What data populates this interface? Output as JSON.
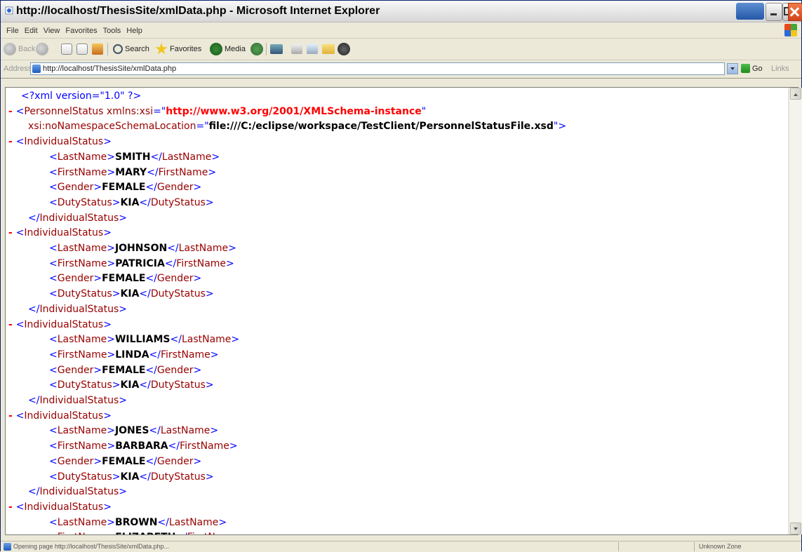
{
  "window": {
    "title": "http://localhost/ThesisSite/xmlData.php - Microsoft Internet Explorer"
  },
  "menu": [
    "File",
    "Edit",
    "View",
    "Favorites",
    "Tools",
    "Help"
  ],
  "toolbar": {
    "back": "Back",
    "search": "Search",
    "favorites": "Favorites",
    "media": "Media"
  },
  "address": {
    "label": "Address",
    "url": "http://localhost/ThesisSite/xmlData.php",
    "go": "Go",
    "links": "Links"
  },
  "xml": {
    "declaration": "<?xml version=\"1.0\" ?>",
    "root_tag": "PersonnelStatus",
    "xmlns_attr": "xmlns:xsi",
    "xmlns_value": "http://www.w3.org/2001/XMLSchema-instance",
    "schema_attr": "xsi:noNamespaceSchemaLocation",
    "schema_value": "file:///C:/eclipse/workspace/TestClient/PersonnelStatusFile.xsd",
    "record_tag": "IndividualStatus",
    "fields": [
      "LastName",
      "FirstName",
      "Gender",
      "DutyStatus"
    ],
    "records": [
      {
        "LastName": "SMITH",
        "FirstName": "MARY",
        "Gender": "FEMALE",
        "DutyStatus": "KIA"
      },
      {
        "LastName": "JOHNSON",
        "FirstName": "PATRICIA",
        "Gender": "FEMALE",
        "DutyStatus": "KIA"
      },
      {
        "LastName": "WILLIAMS",
        "FirstName": "LINDA",
        "Gender": "FEMALE",
        "DutyStatus": "KIA"
      },
      {
        "LastName": "JONES",
        "FirstName": "BARBARA",
        "Gender": "FEMALE",
        "DutyStatus": "KIA"
      },
      {
        "LastName": "BROWN",
        "FirstName": "ELIZABETH"
      }
    ]
  },
  "status": {
    "text": "Opening page http://localhost/ThesisSite/xmlData.php...",
    "zone": "Unknown Zone"
  }
}
